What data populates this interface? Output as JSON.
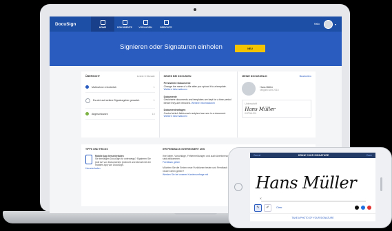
{
  "app": {
    "logo": "DocuSign",
    "nav_tabs": [
      {
        "label": "HOME"
      },
      {
        "label": "DOKUMENTE"
      },
      {
        "label": "VORLAGEN"
      },
      {
        "label": "BERICHTE"
      }
    ],
    "user_greeting": "Hallo"
  },
  "hero": {
    "title": "Signieren oder Signaturen einholen",
    "button_label": "NEU"
  },
  "overview": {
    "heading": "ÜBERSICHT",
    "period": "Letzte 6 Monate",
    "items": [
      {
        "label": "Maßnahme erforderlich",
        "count": "1",
        "color": "#2a5cc0"
      },
      {
        "label": "Es wird auf weitere Signaturgeber gewartet.",
        "count": "1",
        "color": "#9aa1ab"
      },
      {
        "label": "Abgeschlossen",
        "count": "10",
        "color": "#7cb342"
      }
    ]
  },
  "news": {
    "heading": "NEUES BEI DOCUSIGN",
    "items": [
      {
        "title": "Persistente Dokumente",
        "body": "Change the name of a file after you upload it to a template.",
        "link": "Weitere Informationen"
      },
      {
        "title": "Dokumente",
        "body": "Gesicherte documents and templates are kept for a time period before they are removed.",
        "link": "Weitere Informationen"
      },
      {
        "title": "Dokumentvorlagen",
        "body": "Control which fields each recipient can see in a document.",
        "link": "Weitere Informationen"
      }
    ]
  },
  "profile": {
    "heading": "MEINE DOCUSIGN-ID",
    "edit_label": "Bearbeiten",
    "name": "Hans Müller",
    "since": "Mitglied seit 2015",
    "signature_label": "Unterschrift",
    "signature": "Hans Müller",
    "initials_label": "INITIALEN"
  },
  "tips": {
    "heading": "TIPPS UND TRICKS",
    "title": "Mobile App herunterladen",
    "body": "Sie benötigen DocuSign für unterwegs? Signieren Sie jede Art von Dokumenten jederzeit und überall mit der mobilen App von DocuSign.",
    "link": "Herunterladen"
  },
  "feedback": {
    "heading": "IHR FEEDBACK INTERESSIERT UNS",
    "body1": "Ihre Ideen, Vorschläge, Fehlermeldungen und auch Anerkennung sind willkommen.",
    "link1": "Feedback geben",
    "body2": "Möchten Sie die Ersten neue Funktionen testen und Feedback zu neuen Ideen geben?",
    "link2": "Werden Sie bei unserer Kundenumfrage mit"
  },
  "phone": {
    "cancel": "Cancel",
    "title": "DRAW YOUR SIGNATURE",
    "done": "Done",
    "signature": "Hans Müller",
    "sign_x": "X",
    "clear": "Clear",
    "bottom_action": "TAKE A PHOTO OF YOUR SIGNATURE",
    "ink_colors": [
      "#111111",
      "#1e6fe0",
      "#e23232"
    ]
  }
}
